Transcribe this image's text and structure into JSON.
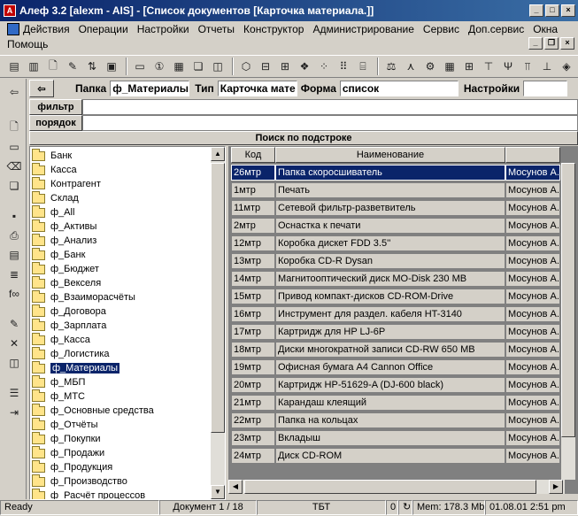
{
  "window": {
    "title": "Алеф 3.2 [alexm - AIS] - [Список документов [Карточка материала.]]",
    "app_icon": "А"
  },
  "menu": {
    "items": [
      "Действия",
      "Операции",
      "Настройки",
      "Отчеты",
      "Конструктор",
      "Администрирование",
      "Сервис",
      "Доп.сервис",
      "Окна"
    ],
    "help": "Помощь"
  },
  "panel": {
    "folder_label": "Папка",
    "folder_value": "ф_Материалы",
    "type_label": "Тип",
    "type_value": "Карточка мате",
    "form_label": "Форма",
    "form_value": "список",
    "settings_label": "Настройки",
    "settings_value": ""
  },
  "filter": {
    "label": "фильтр",
    "value": ""
  },
  "order": {
    "label": "порядок",
    "value": ""
  },
  "search_header": "Поиск по подстроке",
  "tree": {
    "items": [
      "Банк",
      "Касса",
      "Контрагент",
      "Склад",
      "ф_All",
      "ф_Активы",
      "ф_Анализ",
      "ф_Банк",
      "ф_Бюджет",
      "ф_Векселя",
      "ф_Взаиморасчёты",
      "ф_Договора",
      "ф_Зарплата",
      "ф_Касса",
      "ф_Логистика",
      "ф_Материалы",
      "ф_МБП",
      "ф_МТС",
      "ф_Основные средства",
      "ф_Отчёты",
      "ф_Покупки",
      "ф_Продажи",
      "ф_Продукция",
      "ф_Производство",
      "ф_Расчёт процессов"
    ],
    "selected": "ф_Материалы"
  },
  "table": {
    "columns": [
      "Код",
      "Наименование",
      ""
    ],
    "rows": [
      [
        "26мтр",
        "Папка скоросшиватель",
        "Мосунов А."
      ],
      [
        "1мтр",
        "Печать",
        "Мосунов А."
      ],
      [
        "11мтр",
        "Сетевой фильтр-разветвитель",
        "Мосунов А."
      ],
      [
        "2мтр",
        "Оснастка к печати",
        "Мосунов А."
      ],
      [
        "12мтр",
        "Коробка дискет FDD 3.5''",
        "Мосунов А."
      ],
      [
        "13мтр",
        "Коробка CD-R Dysan",
        "Мосунов А."
      ],
      [
        "14мтр",
        "Магнитооптический диск MO-Disk 230 MB",
        "Мосунов А."
      ],
      [
        "15мтр",
        "Привод компакт-дисков CD-ROM-Drive",
        "Мосунов А."
      ],
      [
        "16мтр",
        "Инструмент для раздел. кабеля HT-3140",
        "Мосунов А."
      ],
      [
        "17мтр",
        "Картридж для HP LJ-6P",
        "Мосунов А."
      ],
      [
        "18мтр",
        "Диски многократной записи CD-RW 650 MB",
        "Мосунов А."
      ],
      [
        "19мтр",
        "Офисная бумага A4 Cannon Office",
        "Мосунов А."
      ],
      [
        "20мтр",
        "Картридж HP-51629-A (DJ-600 black)",
        "Мосунов А."
      ],
      [
        "21мтр",
        "Карандаш клеящий",
        "Мосунов А."
      ],
      [
        "22мтр",
        "Папка на кольцах",
        "Мосунов А."
      ],
      [
        "23мтр",
        "Вкладыш",
        "Мосунов А."
      ],
      [
        "24мтр",
        "Диск CD-ROM",
        "Мосунов А."
      ]
    ]
  },
  "status": {
    "ready": "Ready",
    "document": "Документ 1 / 18",
    "currency": "ТБТ",
    "count": "0",
    "memory": "Mem: 178.3 Mb",
    "datetime": "01.08.01 2:51 pm"
  },
  "colors": {
    "title_bar": "#0a246a",
    "selection": "#0a246a",
    "face": "#d4d0c8"
  }
}
